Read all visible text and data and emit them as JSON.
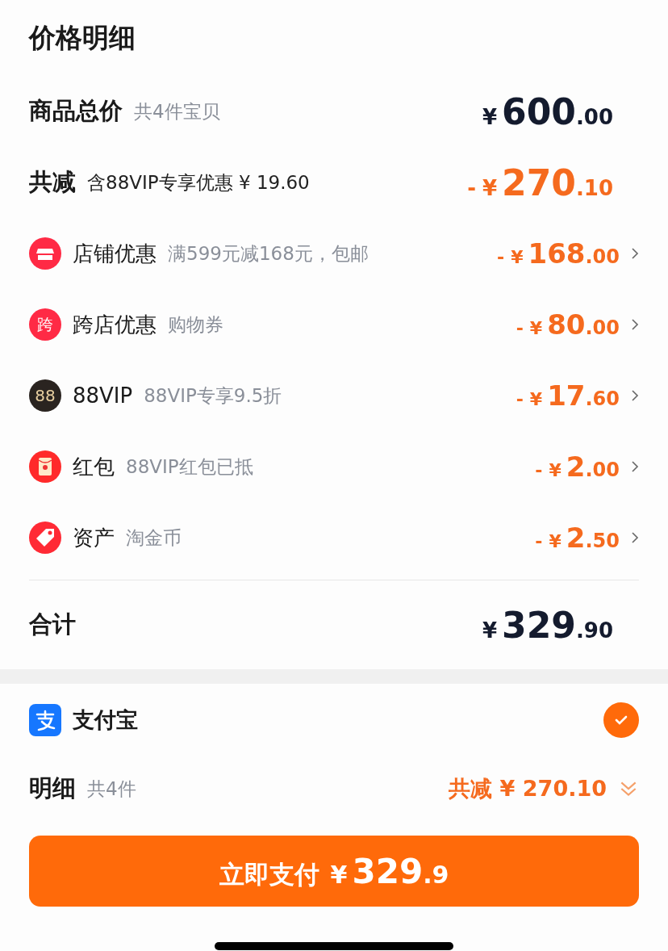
{
  "title": "价格明细",
  "goods_total": {
    "label": "商品总价",
    "note": "共4件宝贝",
    "price": {
      "currency": "¥",
      "integer": "600",
      "fraction": ".00"
    }
  },
  "total_discount": {
    "label": "共减",
    "note": "含88VIP专享优惠 ¥ 19.60",
    "price": {
      "sign": "-",
      "currency": "¥",
      "integer": "270",
      "fraction": ".10"
    }
  },
  "discounts": [
    {
      "kind": "store",
      "label": "店铺优惠",
      "note": "满599元减168元，包邮",
      "price": {
        "sign": "-",
        "currency": "¥",
        "integer": "168",
        "fraction": ".00"
      }
    },
    {
      "kind": "cross",
      "icon_text": "跨",
      "label": "跨店优惠",
      "note": "购物券",
      "price": {
        "sign": "-",
        "currency": "¥",
        "integer": "80",
        "fraction": ".00"
      }
    },
    {
      "kind": "vip",
      "icon_text": "88",
      "label": "88VIP",
      "note": "88VIP专享9.5折",
      "price": {
        "sign": "-",
        "currency": "¥",
        "integer": "17",
        "fraction": ".60"
      }
    },
    {
      "kind": "redpacket",
      "label": "红包",
      "note": "88VIP红包已抵",
      "price": {
        "sign": "-",
        "currency": "¥",
        "integer": "2",
        "fraction": ".00"
      }
    },
    {
      "kind": "asset",
      "label": "资产",
      "note": "淘金币",
      "price": {
        "sign": "-",
        "currency": "¥",
        "integer": "2",
        "fraction": ".50"
      }
    }
  ],
  "sum": {
    "label": "合计",
    "price": {
      "currency": "¥",
      "integer": "329",
      "fraction": ".90"
    }
  },
  "payment": {
    "label": "支付宝",
    "selected": true
  },
  "detail": {
    "label": "明细",
    "note": "共4件",
    "discount": "共减 ¥ 270.10"
  },
  "pay_button": {
    "label": "立即支付",
    "currency": "¥",
    "integer": "329",
    "fraction": ".9"
  }
}
